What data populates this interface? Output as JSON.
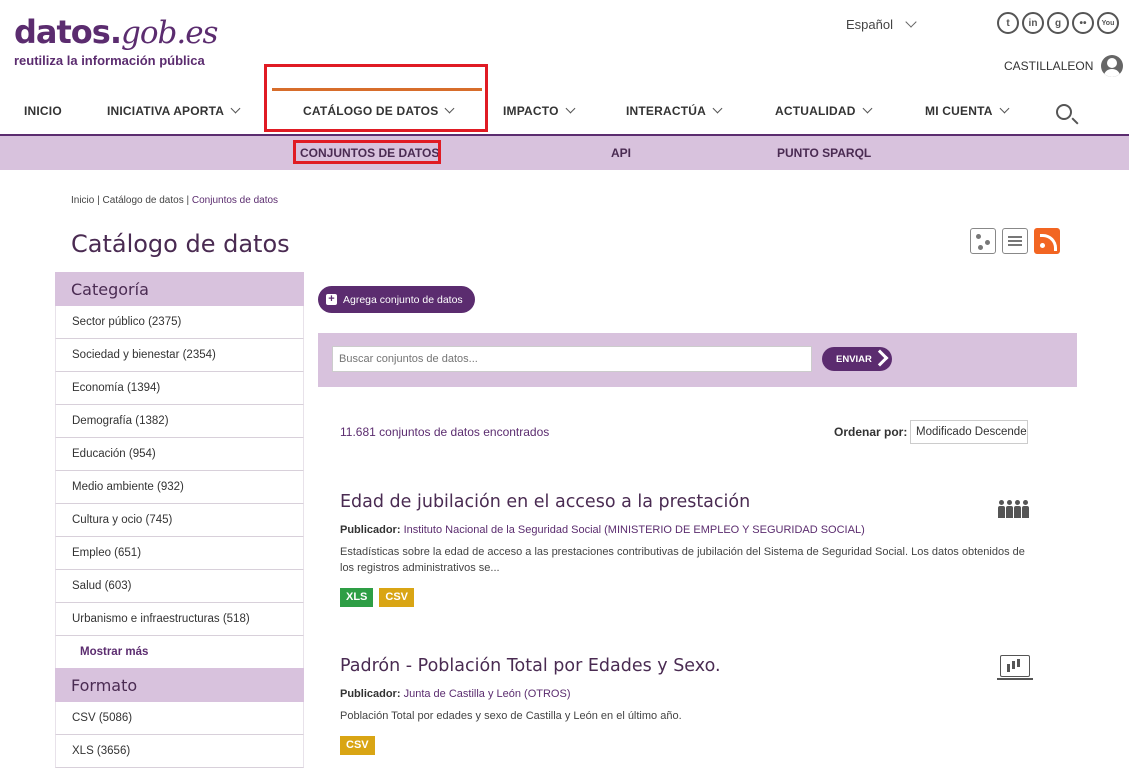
{
  "header": {
    "logo_main": "datos.",
    "logo_gob": "gob.es",
    "logo_sub": "reutiliza la información pública",
    "language": "Español",
    "account_name": "CASTILLALEON",
    "social": [
      {
        "name": "twitter-icon",
        "glyph": "t"
      },
      {
        "name": "linkedin-icon",
        "glyph": "in"
      },
      {
        "name": "github-icon",
        "glyph": "g"
      },
      {
        "name": "flickr-icon",
        "glyph": "••"
      },
      {
        "name": "youtube-icon",
        "glyph": "You"
      }
    ]
  },
  "nav": {
    "items": [
      {
        "label": "INICIO"
      },
      {
        "label": "INICIATIVA APORTA"
      },
      {
        "label": "CATÁLOGO DE DATOS"
      },
      {
        "label": "IMPACTO"
      },
      {
        "label": "INTERACTÚA"
      },
      {
        "label": "ACTUALIDAD"
      },
      {
        "label": "MI CUENTA"
      }
    ],
    "sub_items": [
      {
        "label": "CONJUNTOS DE DATOS"
      },
      {
        "label": "API"
      },
      {
        "label": "PUNTO SPARQL"
      }
    ]
  },
  "breadcrumb": {
    "home": "Inicio",
    "sep": "|",
    "section": "Catálogo de datos",
    "current": "Conjuntos de datos"
  },
  "page": {
    "title": "Catálogo de datos"
  },
  "sidebar": {
    "category_title": "Categoría",
    "categories": [
      "Sector público (2375)",
      "Sociedad y bienestar (2354)",
      "Economía (1394)",
      "Demografía (1382)",
      "Educación (954)",
      "Medio ambiente (932)",
      "Cultura y ocio (745)",
      "Empleo (651)",
      "Salud (603)",
      "Urbanismo e infraestructuras (518)"
    ],
    "show_more": "Mostrar más",
    "format_title": "Formato",
    "formats": [
      "CSV (5086)",
      "XLS (3656)"
    ]
  },
  "content": {
    "add_button": "Agrega conjunto de datos",
    "search_placeholder": "Buscar conjuntos de datos...",
    "send_button": "ENVIAR",
    "results_count": "11.681 conjuntos de datos encontrados",
    "order_label": "Ordenar por:",
    "order_value": "Modificado Descendente",
    "publisher_label": "Publicador:",
    "datasets": [
      {
        "title": "Edad de jubilación en el acceso a la prestación",
        "publisher": "Instituto Nacional de la Seguridad Social (MINISTERIO DE EMPLEO Y SEGURIDAD SOCIAL)",
        "description": "Estadísticas sobre la edad de acceso a las prestaciones contributivas de jubilación del Sistema de Seguridad Social. Los datos obtenidos de los registros administrativos se...",
        "formats": [
          "XLS",
          "CSV"
        ],
        "icon": "people-icon"
      },
      {
        "title": "Padrón - Población Total por Edades y Sexo.",
        "publisher": "Junta de Castilla y León (OTROS)",
        "description": "Población Total por edades y sexo de Castilla y León en el último año.",
        "formats": [
          "CSV"
        ],
        "icon": "screen-chart-icon"
      }
    ]
  },
  "colors": {
    "brand_purple": "#5b2c6f",
    "subnav_lilac": "#d8c2dd",
    "active_orange": "#d76d2b",
    "highlight_red": "#e01b24",
    "tag_xls": "#2e9e45",
    "tag_csv": "#d9a514"
  }
}
